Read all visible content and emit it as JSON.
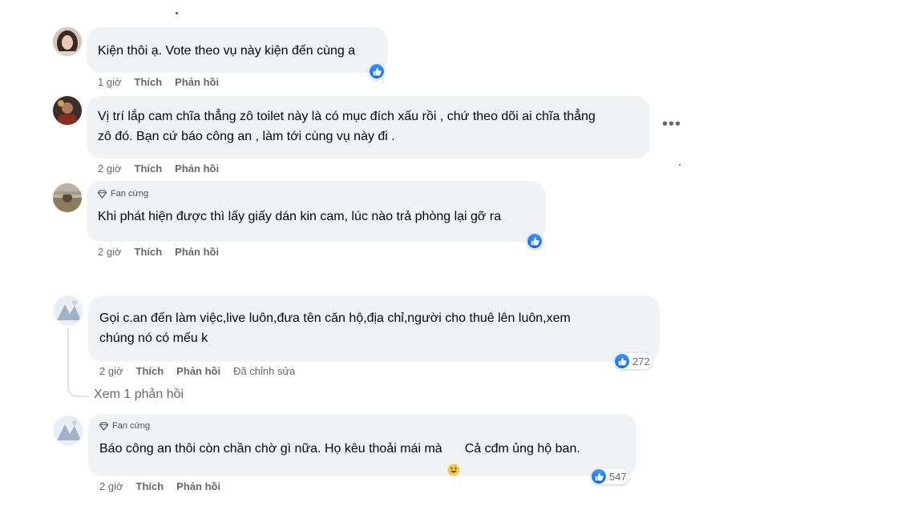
{
  "actions": {
    "like": "Thích",
    "reply": "Phản hồi"
  },
  "comments": [
    {
      "text": "Kiện thôi ạ. Vote theo vụ này kiện đến cùng a",
      "time": "1 giờ",
      "badge": "",
      "reactions": "",
      "edited": ""
    },
    {
      "text": "Vị trí lắp cam chĩa thẳng zô toilet này là có mục đích xấu rồi , chứ theo dõi ai chĩa thẳng\nzô đó. Bạn cứ báo công an , làm tới cùng vụ này đi .",
      "time": "2 giờ",
      "badge": "",
      "reactions": "",
      "edited": ""
    },
    {
      "text": "Khi phát hiện được thì lấy giấy dán kin cam, lúc nào trả phòng lại gỡ ra",
      "time": "2 giờ",
      "badge": "Fan cứng",
      "reactions": "",
      "edited": ""
    },
    {
      "text": "Gọi c.an đến làm việc,live luôn,đưa tên căn hộ,địa chỉ,người cho thuê lên luôn,xem\nchúng nó có mếu k",
      "time": "2 giờ",
      "badge": "",
      "reactions": "272",
      "edited": "Đã chỉnh sửa"
    },
    {
      "text": "Báo công an thôi còn chần chờ gì nữa. Họ kêu thoải mái mà",
      "text_after_emoji": "Cả cđm ủng hộ ban.",
      "time": "2 giờ",
      "badge": "Fan cứng",
      "reactions": "547",
      "edited": ""
    }
  ],
  "view_replies": "Xem 1 phản hồi",
  "icons": {
    "like": "thumbs-up-icon",
    "more": "more-options-icon",
    "badge": "diamond-icon",
    "emoji": "grinning-face-emoji"
  },
  "colors": {
    "like_blue": "#0866ff",
    "bubble": "#f0f2f5",
    "secondary_text": "#65676b"
  }
}
